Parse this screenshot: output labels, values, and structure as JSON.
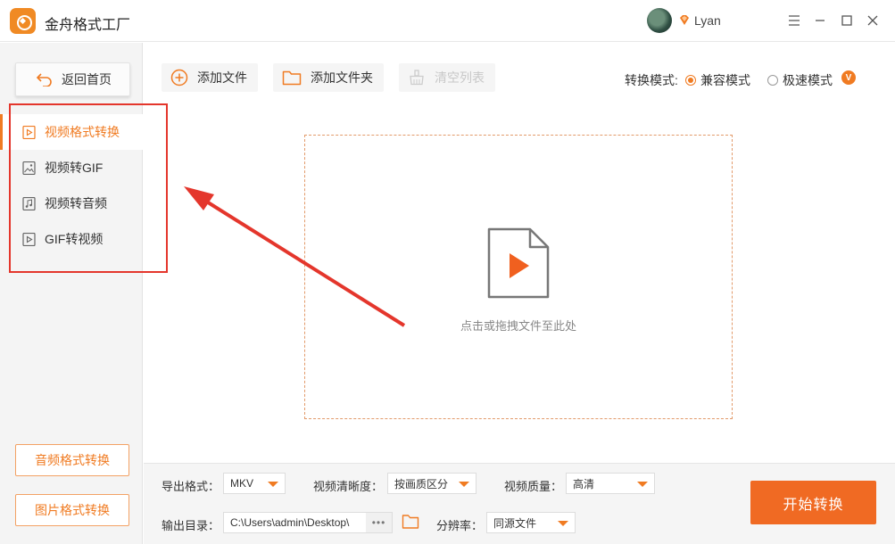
{
  "app": {
    "title": "金舟格式工厂"
  },
  "user": {
    "name": "Lyan"
  },
  "sidebar": {
    "back_label": "返回首页",
    "items": [
      {
        "label": "视频格式转换",
        "icon": "video-file-icon",
        "active": true
      },
      {
        "label": "视频转GIF",
        "icon": "image-file-icon",
        "active": false
      },
      {
        "label": "视频转音频",
        "icon": "music-file-icon",
        "active": false
      },
      {
        "label": "GIF转视频",
        "icon": "video-file-icon",
        "active": false
      }
    ],
    "audio_convert_label": "音频格式转换",
    "image_convert_label": "图片格式转换"
  },
  "toolbar": {
    "add_file_label": "添加文件",
    "add_folder_label": "添加文件夹",
    "clear_list_label": "清空列表",
    "mode_label": "转换模式:",
    "mode_options": [
      "兼容模式",
      "极速模式"
    ],
    "mode_selected": "兼容模式",
    "vip_badge": "V"
  },
  "dropzone": {
    "hint": "点击或拖拽文件至此处"
  },
  "settings": {
    "export_format_label": "导出格式：",
    "export_format_value": "MKV",
    "video_clarity_label": "视频清晰度：",
    "video_clarity_value": "按画质区分",
    "video_quality_label": "视频质量：",
    "video_quality_value": "高清",
    "output_dir_label": "输出目录：",
    "output_dir_value": "C:\\Users\\admin\\Desktop\\",
    "more_label": "•••",
    "resolution_label": "分辨率：",
    "resolution_value": "同源文件",
    "start_label": "开始转换"
  },
  "colors": {
    "accent": "#f07b22",
    "highlight": "#e4362c"
  }
}
